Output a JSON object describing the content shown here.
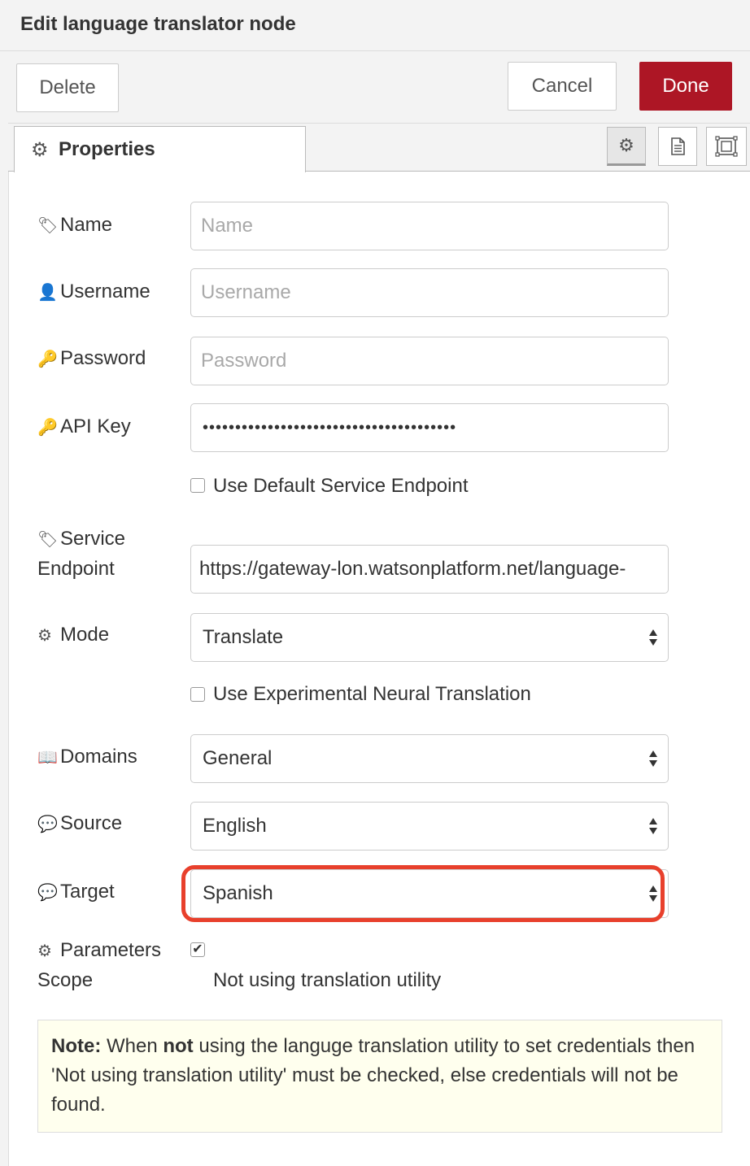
{
  "dialog": {
    "title": "Edit language translator node"
  },
  "toolbar": {
    "delete_label": "Delete",
    "cancel_label": "Cancel",
    "done_label": "Done"
  },
  "tabs": {
    "properties_label": "Properties",
    "properties_icon": "gear-icon",
    "icon_buttons": [
      "gear-icon",
      "description-icon",
      "appearance-icon"
    ]
  },
  "form": {
    "name": {
      "label": "Name",
      "icon": "tag-icon",
      "placeholder": "Name",
      "value": ""
    },
    "username": {
      "label": "Username",
      "icon": "user-icon",
      "placeholder": "Username",
      "value": ""
    },
    "password": {
      "label": "Password",
      "icon": "key-icon",
      "placeholder": "Password",
      "value": ""
    },
    "api_key": {
      "label": "API Key",
      "icon": "key-icon",
      "value": "•••••••••••••••••••••••••••••••••••••••"
    },
    "default_endpoint": {
      "label": "Use Default Service Endpoint",
      "checked": false
    },
    "service_endpoint": {
      "label_line1": "Service",
      "label_line2": "Endpoint",
      "icon": "tag-icon",
      "value": "https://gateway-lon.watsonplatform.net/language-"
    },
    "mode": {
      "label": "Mode",
      "icon": "gear-icon",
      "value": "Translate"
    },
    "neural": {
      "label": "Use Experimental Neural Translation",
      "checked": false
    },
    "domains": {
      "label": "Domains",
      "icon": "book-icon",
      "value": "General"
    },
    "source": {
      "label": "Source",
      "icon": "comments-icon",
      "value": "English"
    },
    "target": {
      "label": "Target",
      "icon": "comments-icon",
      "value": "Spanish"
    },
    "params_scope": {
      "label_line1": "Parameters",
      "label_line2": "Scope",
      "icon": "gear-icon",
      "checked": true,
      "checkbox_label": "Not using translation utility"
    }
  },
  "note": {
    "prefix": "Note:",
    "text_1": " When ",
    "emph": "not",
    "text_2": " using the languge translation utility to set credentials then 'Not using translation utility' must be checked, else credentials will not be found."
  },
  "colors": {
    "done_button": "#ad1625",
    "highlight": "#e8402c",
    "note_background": "#ffffee"
  }
}
